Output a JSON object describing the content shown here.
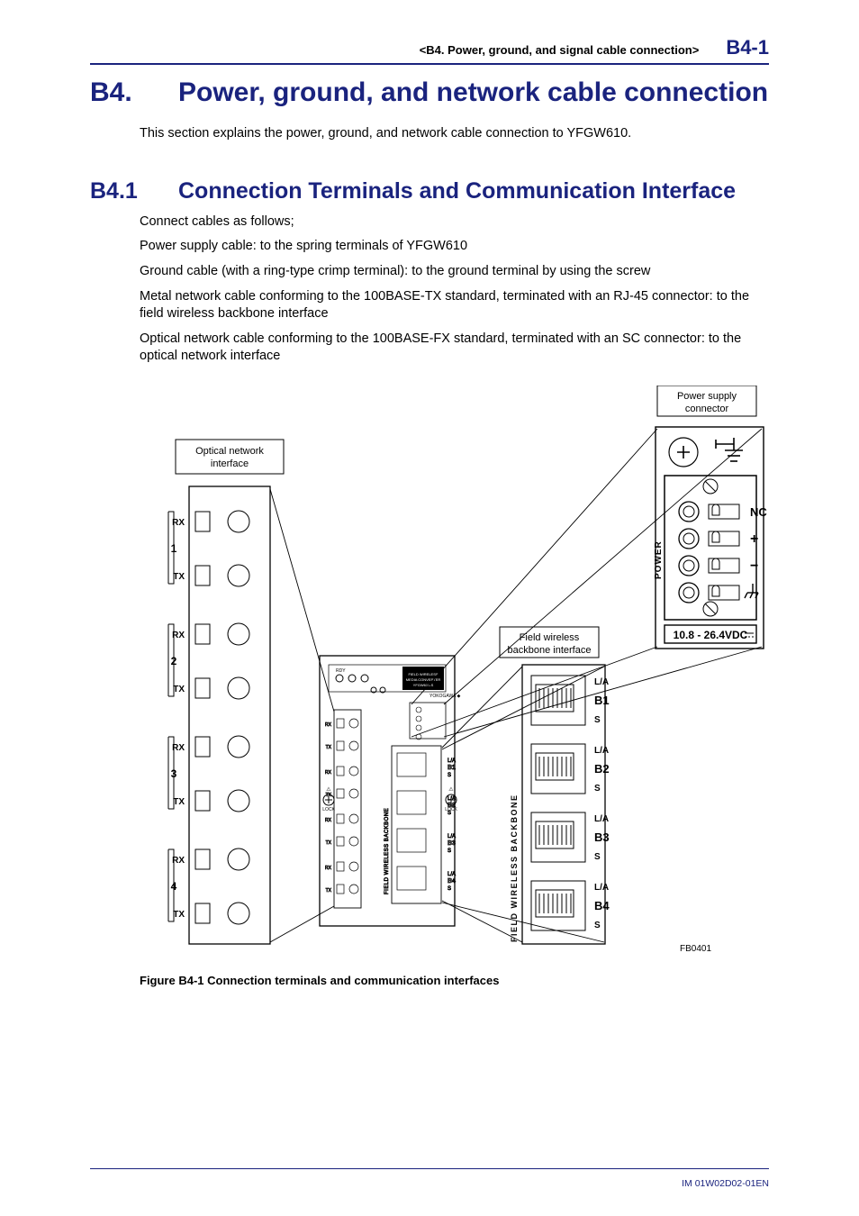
{
  "header": {
    "running_head": "<B4.  Power, ground, and signal cable connection>",
    "page_number": "B4-1"
  },
  "h1": {
    "number": "B4.",
    "title": "Power, ground, and network cable connection"
  },
  "intro": "This section explains the power, ground, and network cable connection to YFGW610.",
  "h2": {
    "number": "B4.1",
    "title": "Connection Terminals and Communication Interface"
  },
  "paragraphs": {
    "p1": "Connect cables as follows;",
    "p2": "Power supply cable: to the spring terminals of YFGW610",
    "p3": "Ground cable (with a ring-type crimp terminal): to the ground terminal by using the screw",
    "p4": "Metal network cable conforming to the 100BASE-TX standard, terminated with an RJ-45 connector: to the field wireless backbone interface",
    "p5": "Optical network cable conforming to the 100BASE-FX standard, terminated with an SC connector: to the optical network interface"
  },
  "figure": {
    "labels": {
      "optical": "Optical network\ninterface",
      "power": "Power supply\nconnector",
      "fwb": "Field wireless\nbackbone interface"
    },
    "optical_ports": [
      {
        "num": "1",
        "rx": "RX",
        "tx": "TX"
      },
      {
        "num": "2",
        "rx": "RX",
        "tx": "TX"
      },
      {
        "num": "3",
        "rx": "RX",
        "tx": "TX"
      },
      {
        "num": "4",
        "rx": "RX",
        "tx": "TX"
      }
    ],
    "backbone_ports": [
      "B1",
      "B2",
      "B3",
      "B4"
    ],
    "backbone_side_text": "FIELD WIRELESS BACKBONE",
    "power_terminals": [
      "NC",
      "+",
      "−",
      "⏚"
    ],
    "power_side_text": "POWER",
    "power_range": "10.8 - 26.4VDC",
    "ref": "FB0401",
    "caption": "Figure B4-1    Connection terminals and communication interfaces"
  },
  "footer": {
    "doc_id": "IM 01W02D02-01EN"
  }
}
